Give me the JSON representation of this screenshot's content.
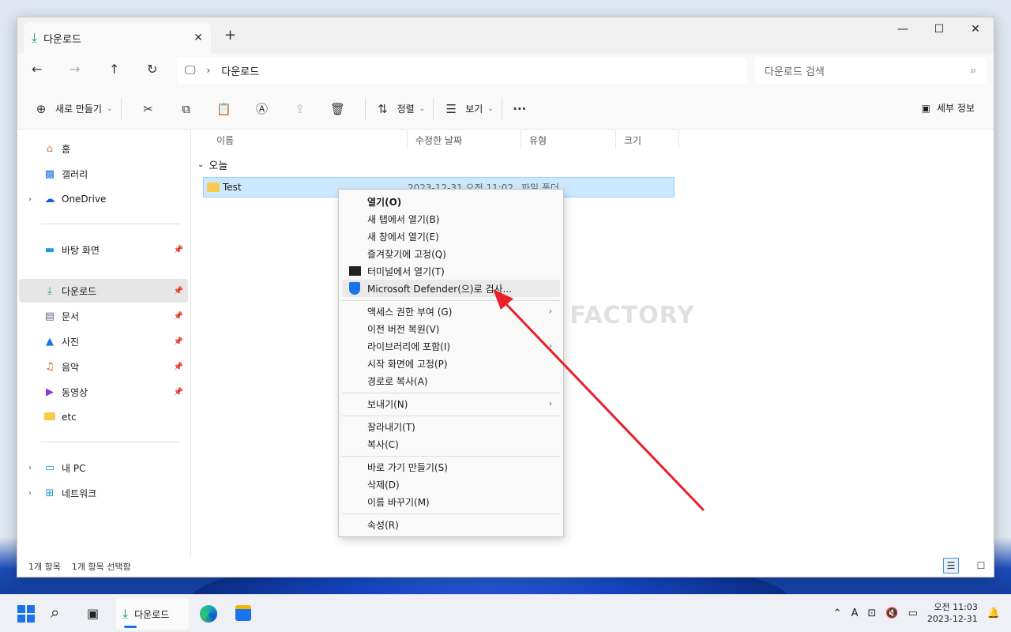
{
  "window": {
    "tab_title": "다운로드",
    "close_tab": "✕",
    "new_tab": "+",
    "min": "—",
    "max": "☐",
    "close": "✕"
  },
  "nav": {
    "back": "←",
    "forward": "→",
    "up": "↑",
    "refresh": "↻",
    "breadcrumb": "다운로드",
    "search_placeholder": "다운로드 검색"
  },
  "toolbar": {
    "new_label": "새로 만들기",
    "sort_label": "정렬",
    "view_label": "보기",
    "more": "···",
    "details_label": "세부 정보"
  },
  "sidebar": {
    "items": [
      {
        "label": "홈"
      },
      {
        "label": "갤러리"
      },
      {
        "label": "OneDrive"
      },
      {
        "label": "바탕 화면"
      },
      {
        "label": "다운로드"
      },
      {
        "label": "문서"
      },
      {
        "label": "사진"
      },
      {
        "label": "음악"
      },
      {
        "label": "동영상"
      },
      {
        "label": "etc"
      },
      {
        "label": "내 PC"
      },
      {
        "label": "네트워크"
      }
    ]
  },
  "columns": {
    "name": "이름",
    "modified": "수정한 날짜",
    "type": "유형",
    "size": "크기"
  },
  "group": {
    "label": "오늘"
  },
  "file": {
    "name": "Test",
    "modified": "2023-12-31 오전 11:02",
    "type": "파일 폴더"
  },
  "context_menu": {
    "open": "열기(O)",
    "open_new_tab": "새 탭에서 열기(B)",
    "open_new_window": "새 창에서 열기(E)",
    "pin_quick": "즐겨찾기에 고정(Q)",
    "open_terminal": "터미널에서 열기(T)",
    "defender": "Microsoft Defender(으)로 검사...",
    "access": "액세스 권한 부여 (G)",
    "restore": "이전 버전 복원(V)",
    "library": "라이브러리에 포함(I)",
    "pin_start": "시작 화면에 고정(P)",
    "copy_path": "경로로 복사(A)",
    "send_to": "보내기(N)",
    "cut": "잘라내기(T)",
    "copy": "복사(C)",
    "shortcut": "바로 가기 만들기(S)",
    "delete": "삭제(D)",
    "rename": "이름 바꾸기(M)",
    "properties": "속성(R)"
  },
  "watermark": "MANUAL FACTORY",
  "status": {
    "count": "1개 항목",
    "selected": "1개 항목 선택함"
  },
  "taskbar": {
    "active_label": "다운로드",
    "time": "오전 11:03",
    "date": "2023-12-31"
  },
  "colors": {
    "accent": "#1a73e8",
    "selection": "#cce8ff",
    "arrow": "#e8202a"
  }
}
